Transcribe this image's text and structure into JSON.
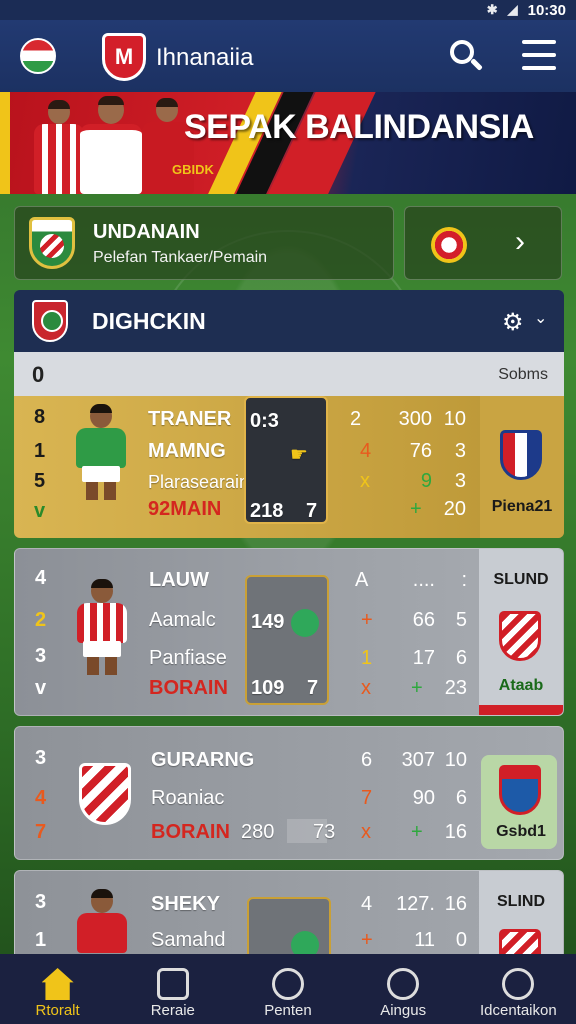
{
  "status_bar": {
    "time": "10:30"
  },
  "app_bar": {
    "title": "Ihnanaiia"
  },
  "banner": {
    "title": "SEPAK BALINDANSIA",
    "subtitle": "GBIDK"
  },
  "league": {
    "title": "UNDANAIN",
    "subtitle": "Pelefan Tankaer/Pemain"
  },
  "section": {
    "title": "DIGHCKIN"
  },
  "table_header": {
    "rank": "0",
    "right": "Sobms"
  },
  "cards": [
    {
      "ranks": [
        "8",
        "1",
        "5",
        "v"
      ],
      "lines": [
        "TRANER",
        "MAMNG",
        "Plarasearain",
        "92MAIN"
      ],
      "score_top": "0:3",
      "score_bottom_left": "218",
      "score_bottom_right": "7",
      "stats": [
        [
          "2",
          "300",
          "10"
        ],
        [
          "4",
          "76",
          "3"
        ],
        [
          "x",
          "9",
          "3"
        ],
        [
          "+",
          "+",
          "20"
        ]
      ],
      "side_label": "Piena21"
    },
    {
      "ranks": [
        "4",
        "2",
        "3",
        "v"
      ],
      "lines": [
        "LAUW",
        "Aamalc",
        "Panfiase",
        "BORAIN"
      ],
      "score_top": "149",
      "score_bottom_left": "109",
      "score_bottom_right": "7",
      "stats": [
        [
          "A",
          "....",
          ":"
        ],
        [
          "+",
          "66",
          "5"
        ],
        [
          "1",
          "17",
          "6"
        ],
        [
          "x",
          "+",
          "23"
        ]
      ],
      "side_top": "SLUND",
      "side_label": "Ataab"
    },
    {
      "ranks": [
        "3",
        "4",
        "7"
      ],
      "lines": [
        "GURARNG",
        "Roaniac",
        "BORAIN"
      ],
      "score_bottom_left": "280",
      "score_bottom_right": "73",
      "stats": [
        [
          "6",
          "307",
          "10"
        ],
        [
          "7",
          "90",
          "6"
        ],
        [
          "x",
          "+",
          "16"
        ]
      ],
      "side_label": "Gsbd1"
    },
    {
      "ranks": [
        "3",
        "1"
      ],
      "lines": [
        "SHEKY",
        "Samahd"
      ],
      "stats": [
        [
          "4",
          "127.",
          "16"
        ],
        [
          "+",
          "11",
          "0"
        ]
      ],
      "side_top": "SLIND"
    }
  ],
  "bottom_nav": [
    {
      "label": "Rtoralt",
      "icon": "home-icon",
      "active": true
    },
    {
      "label": "Reraie",
      "icon": "shield-icon",
      "active": false
    },
    {
      "label": "Penten",
      "icon": "clock-icon",
      "active": false
    },
    {
      "label": "Aingus",
      "icon": "user-group-icon",
      "active": false
    },
    {
      "label": "Idcentaikon",
      "icon": "profile-icon",
      "active": false
    }
  ],
  "colors": {
    "primary": "#1c3162",
    "accent": "#f0c419",
    "red": "#d11f27",
    "pitch": "#3f8a32"
  }
}
